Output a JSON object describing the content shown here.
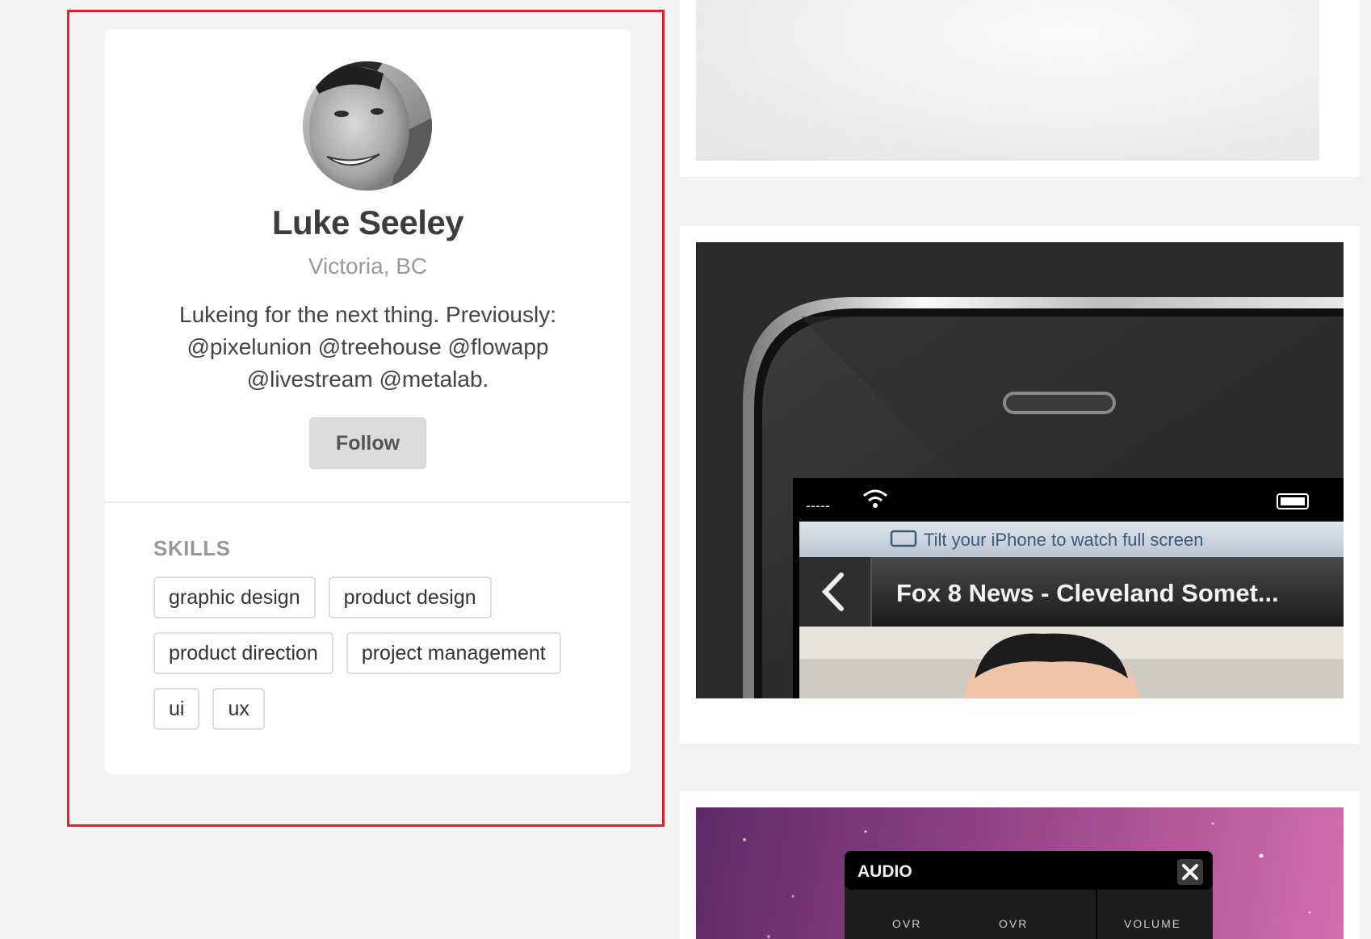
{
  "profile": {
    "name": "Luke Seeley",
    "location": "Victoria, BC",
    "bio": "Lukeing for the next thing. Previously: @pixelunion @treehouse @flowapp @livestream @metalab.",
    "follow_label": "Follow"
  },
  "skills": {
    "heading": "SKILLS",
    "items": [
      "graphic design",
      "product design",
      "product direction",
      "project management",
      "ui",
      "ux"
    ]
  },
  "shots": {
    "phone": {
      "banner": "Tilt your iPhone to watch full screen",
      "title": "Fox 8 News - Cleveland Somet...",
      "carrier": "-----"
    },
    "audio": {
      "title": "AUDIO",
      "labels": [
        "OVR",
        "OVR",
        "VOLUME"
      ]
    }
  },
  "colors": {
    "highlight": "#e0232f",
    "background": "#f3f3f3"
  }
}
